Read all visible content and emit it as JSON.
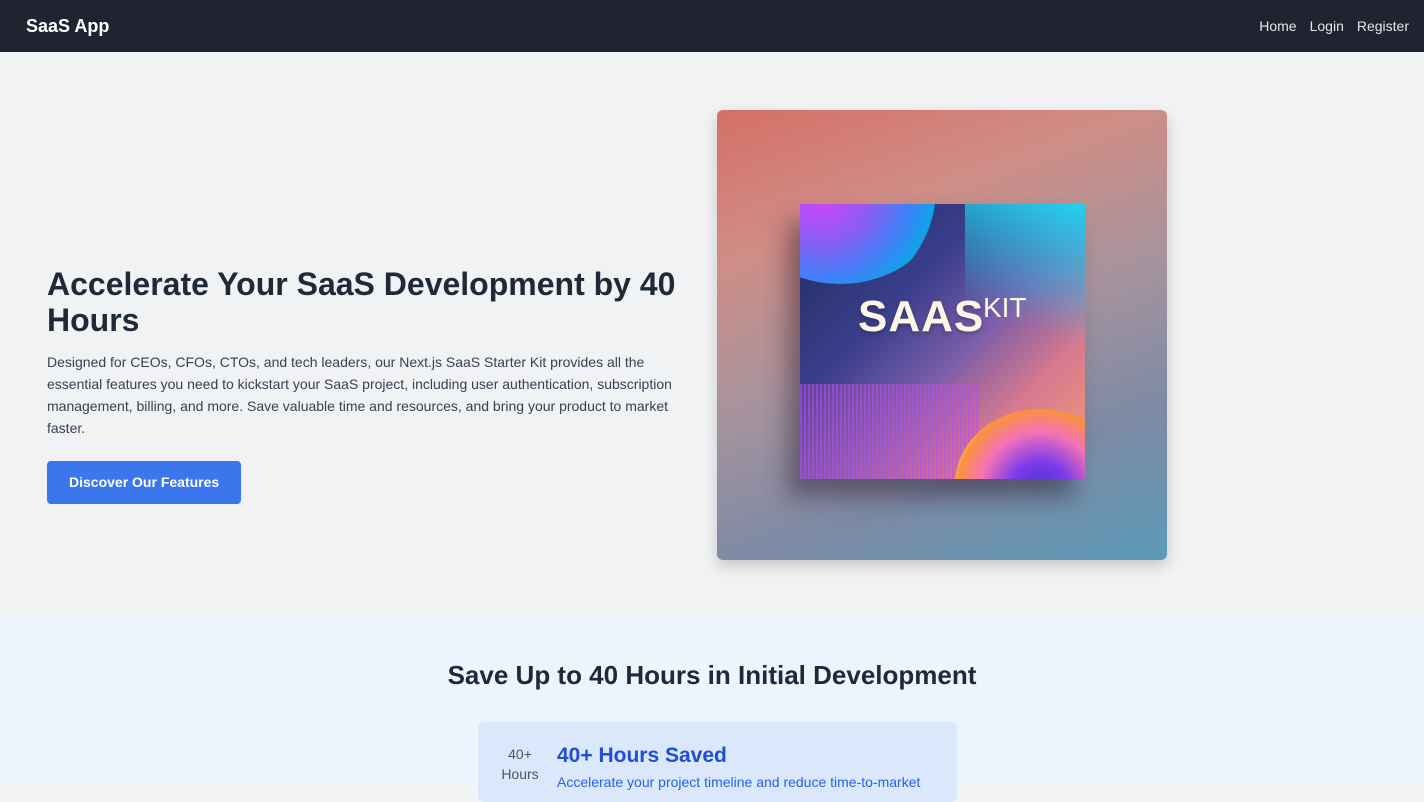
{
  "navbar": {
    "brand": "SaaS App",
    "links": [
      "Home",
      "Login",
      "Register"
    ]
  },
  "hero": {
    "title": "Accelerate Your SaaS Development by 40 Hours",
    "description": "Designed for CEOs, CFOs, CTOs, and tech leaders, our Next.js SaaS Starter Kit provides all the essential features you need to kickstart your SaaS project, including user authentication, subscription management, billing, and more. Save valuable time and resources, and bring your product to market faster.",
    "cta_label": "Discover Our Features",
    "image_text_main": "SAAS",
    "image_text_small": "KIT"
  },
  "savings_section": {
    "title": "Save Up to 40 Hours in Initial Development",
    "feature": {
      "image_alt": "40+ Hours",
      "title": "40+ Hours Saved",
      "description": "Accelerate your project timeline and reduce time-to-market"
    }
  },
  "colors": {
    "navbar_bg": "#1f2430",
    "cta_bg": "#3b76ec",
    "feature_title": "#1d4ed8"
  }
}
